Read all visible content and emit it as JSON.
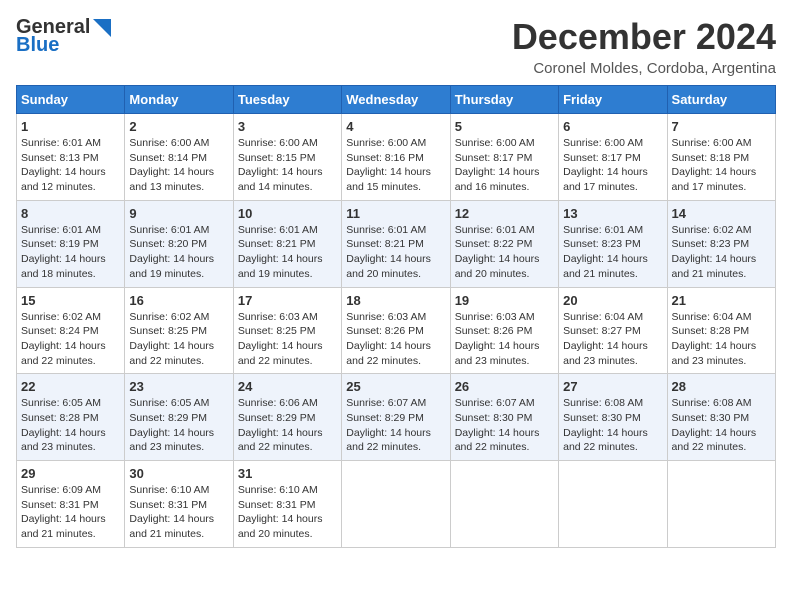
{
  "header": {
    "logo_general": "General",
    "logo_blue": "Blue",
    "month_title": "December 2024",
    "subtitle": "Coronel Moldes, Cordoba, Argentina"
  },
  "calendar": {
    "days_of_week": [
      "Sunday",
      "Monday",
      "Tuesday",
      "Wednesday",
      "Thursday",
      "Friday",
      "Saturday"
    ],
    "weeks": [
      [
        {
          "day": "1",
          "sunrise": "6:01 AM",
          "sunset": "8:13 PM",
          "daylight": "14 hours and 12 minutes."
        },
        {
          "day": "2",
          "sunrise": "6:00 AM",
          "sunset": "8:14 PM",
          "daylight": "14 hours and 13 minutes."
        },
        {
          "day": "3",
          "sunrise": "6:00 AM",
          "sunset": "8:15 PM",
          "daylight": "14 hours and 14 minutes."
        },
        {
          "day": "4",
          "sunrise": "6:00 AM",
          "sunset": "8:16 PM",
          "daylight": "14 hours and 15 minutes."
        },
        {
          "day": "5",
          "sunrise": "6:00 AM",
          "sunset": "8:17 PM",
          "daylight": "14 hours and 16 minutes."
        },
        {
          "day": "6",
          "sunrise": "6:00 AM",
          "sunset": "8:17 PM",
          "daylight": "14 hours and 17 minutes."
        },
        {
          "day": "7",
          "sunrise": "6:00 AM",
          "sunset": "8:18 PM",
          "daylight": "14 hours and 17 minutes."
        }
      ],
      [
        {
          "day": "8",
          "sunrise": "6:01 AM",
          "sunset": "8:19 PM",
          "daylight": "14 hours and 18 minutes."
        },
        {
          "day": "9",
          "sunrise": "6:01 AM",
          "sunset": "8:20 PM",
          "daylight": "14 hours and 19 minutes."
        },
        {
          "day": "10",
          "sunrise": "6:01 AM",
          "sunset": "8:21 PM",
          "daylight": "14 hours and 19 minutes."
        },
        {
          "day": "11",
          "sunrise": "6:01 AM",
          "sunset": "8:21 PM",
          "daylight": "14 hours and 20 minutes."
        },
        {
          "day": "12",
          "sunrise": "6:01 AM",
          "sunset": "8:22 PM",
          "daylight": "14 hours and 20 minutes."
        },
        {
          "day": "13",
          "sunrise": "6:01 AM",
          "sunset": "8:23 PM",
          "daylight": "14 hours and 21 minutes."
        },
        {
          "day": "14",
          "sunrise": "6:02 AM",
          "sunset": "8:23 PM",
          "daylight": "14 hours and 21 minutes."
        }
      ],
      [
        {
          "day": "15",
          "sunrise": "6:02 AM",
          "sunset": "8:24 PM",
          "daylight": "14 hours and 22 minutes."
        },
        {
          "day": "16",
          "sunrise": "6:02 AM",
          "sunset": "8:25 PM",
          "daylight": "14 hours and 22 minutes."
        },
        {
          "day": "17",
          "sunrise": "6:03 AM",
          "sunset": "8:25 PM",
          "daylight": "14 hours and 22 minutes."
        },
        {
          "day": "18",
          "sunrise": "6:03 AM",
          "sunset": "8:26 PM",
          "daylight": "14 hours and 22 minutes."
        },
        {
          "day": "19",
          "sunrise": "6:03 AM",
          "sunset": "8:26 PM",
          "daylight": "14 hours and 23 minutes."
        },
        {
          "day": "20",
          "sunrise": "6:04 AM",
          "sunset": "8:27 PM",
          "daylight": "14 hours and 23 minutes."
        },
        {
          "day": "21",
          "sunrise": "6:04 AM",
          "sunset": "8:28 PM",
          "daylight": "14 hours and 23 minutes."
        }
      ],
      [
        {
          "day": "22",
          "sunrise": "6:05 AM",
          "sunset": "8:28 PM",
          "daylight": "14 hours and 23 minutes."
        },
        {
          "day": "23",
          "sunrise": "6:05 AM",
          "sunset": "8:29 PM",
          "daylight": "14 hours and 23 minutes."
        },
        {
          "day": "24",
          "sunrise": "6:06 AM",
          "sunset": "8:29 PM",
          "daylight": "14 hours and 22 minutes."
        },
        {
          "day": "25",
          "sunrise": "6:07 AM",
          "sunset": "8:29 PM",
          "daylight": "14 hours and 22 minutes."
        },
        {
          "day": "26",
          "sunrise": "6:07 AM",
          "sunset": "8:30 PM",
          "daylight": "14 hours and 22 minutes."
        },
        {
          "day": "27",
          "sunrise": "6:08 AM",
          "sunset": "8:30 PM",
          "daylight": "14 hours and 22 minutes."
        },
        {
          "day": "28",
          "sunrise": "6:08 AM",
          "sunset": "8:30 PM",
          "daylight": "14 hours and 22 minutes."
        }
      ],
      [
        {
          "day": "29",
          "sunrise": "6:09 AM",
          "sunset": "8:31 PM",
          "daylight": "14 hours and 21 minutes."
        },
        {
          "day": "30",
          "sunrise": "6:10 AM",
          "sunset": "8:31 PM",
          "daylight": "14 hours and 21 minutes."
        },
        {
          "day": "31",
          "sunrise": "6:10 AM",
          "sunset": "8:31 PM",
          "daylight": "14 hours and 20 minutes."
        },
        null,
        null,
        null,
        null
      ]
    ]
  }
}
